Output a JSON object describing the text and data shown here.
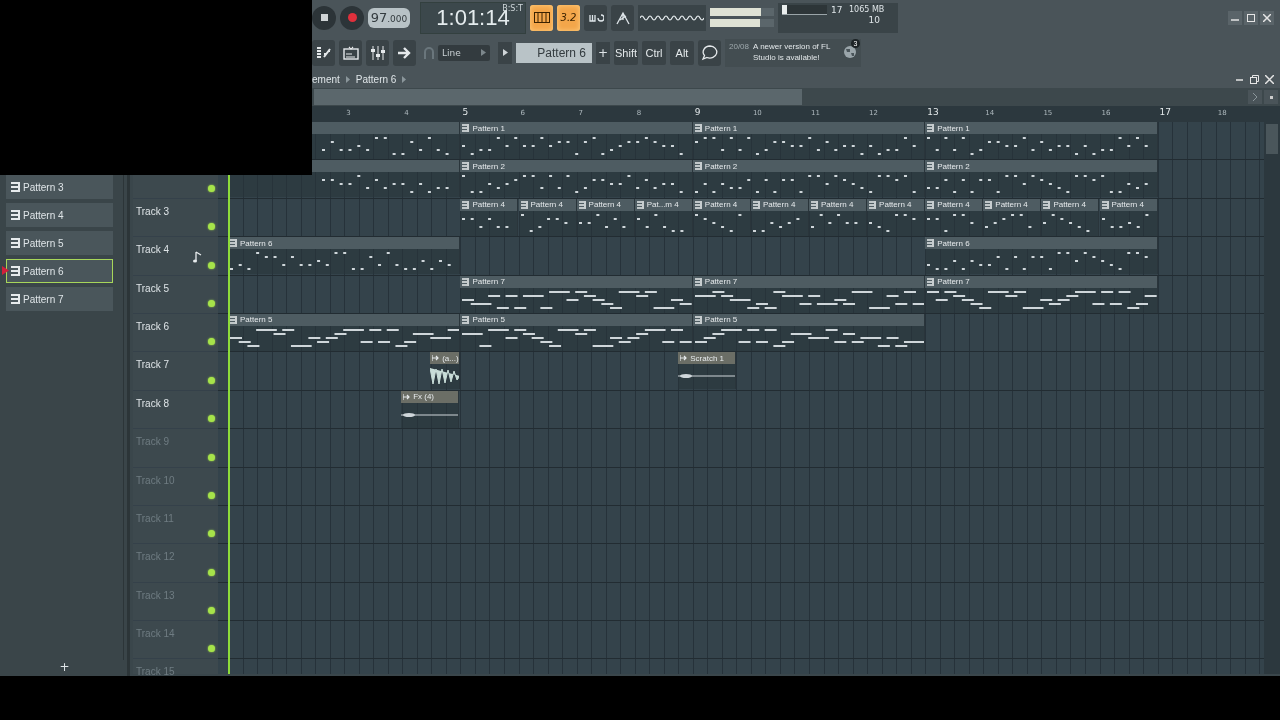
{
  "toolbar": {
    "transport": [
      {
        "kind": "stop"
      },
      {
        "kind": "record"
      }
    ],
    "tempo": {
      "whole": "97",
      "fraction": ".000"
    },
    "song_position": "1:01:14",
    "time_format": "B:S:T",
    "mode_buttons": [
      {
        "kind": "keyboard",
        "on": true
      },
      {
        "kind": "step",
        "label": "3.2",
        "on": true
      },
      {
        "kind": "loop",
        "on": false
      },
      {
        "kind": "metronome",
        "on": false
      }
    ],
    "sliders": [
      {
        "level": 0.8
      },
      {
        "level": 0.78
      }
    ],
    "cpu": {
      "level": 0.1,
      "polyphony": "17",
      "memory": "1065 MB",
      "voices": "10"
    },
    "tools": [
      {
        "kind": "playlist"
      },
      {
        "kind": "channels"
      },
      {
        "kind": "mixer"
      },
      {
        "kind": "arrow"
      }
    ],
    "snap": "Line",
    "pattern": "Pattern 6",
    "pattern_add": "+",
    "modifiers": [
      "Shift",
      "Ctrl",
      "Alt"
    ],
    "hint": {
      "date": "20/08",
      "text": "A newer version of FL Studio is available!",
      "badge": "3"
    }
  },
  "pattern_picker": {
    "items": [
      {
        "label": "Pattern 3",
        "selected": false
      },
      {
        "label": "Pattern 4",
        "selected": false
      },
      {
        "label": "Pattern 5",
        "selected": false
      },
      {
        "label": "Pattern 6",
        "selected": true
      },
      {
        "label": "Pattern 7",
        "selected": false
      }
    ],
    "add": "+"
  },
  "playlist": {
    "breadcrumb": [
      "ement",
      "Pattern 6"
    ],
    "ruler": [
      "3",
      "4",
      "5",
      "6",
      "7",
      "8",
      "9",
      "10",
      "11",
      "12",
      "13",
      "14",
      "15",
      "16",
      "17",
      "18"
    ],
    "tracks": [
      {
        "clips": [
          {
            "kind": "pattern"
          },
          {
            "kind": "pattern",
            "label": "Pattern 1"
          },
          {
            "kind": "pattern",
            "label": "Pattern 1"
          },
          {
            "kind": "pattern",
            "label": "Pattern 1"
          }
        ]
      },
      {
        "enabled": true,
        "clips": [
          {
            "kind": "pattern"
          },
          {
            "kind": "pattern",
            "label": "Pattern 2"
          },
          {
            "kind": "pattern",
            "label": "Pattern 2"
          },
          {
            "kind": "pattern",
            "label": "Pattern 2"
          }
        ]
      },
      {
        "name": "Track 3",
        "empty": false,
        "enabled": true,
        "clips": [
          {
            "kind": "pattern",
            "label": "Pattern 4"
          },
          {
            "kind": "pattern",
            "label": "Pattern 4"
          },
          {
            "kind": "pattern",
            "label": "Pattern 4"
          },
          {
            "kind": "pattern",
            "label": "Pat...m 4"
          },
          {
            "kind": "pattern",
            "label": "Pattern 4"
          },
          {
            "kind": "pattern",
            "label": "Pattern 4"
          },
          {
            "kind": "pattern",
            "label": "Pattern 4"
          },
          {
            "kind": "pattern",
            "label": "Pattern 4"
          },
          {
            "kind": "pattern",
            "label": "Pattern 4"
          },
          {
            "kind": "pattern",
            "label": "Pattern 4"
          },
          {
            "kind": "pattern",
            "label": "Pattern 4"
          },
          {
            "kind": "pattern",
            "label": "Pattern 4"
          }
        ]
      },
      {
        "name": "Track 4",
        "empty": false,
        "enabled": true,
        "current": true,
        "clips": [
          {
            "kind": "pattern",
            "label": "Pattern 6"
          },
          {
            "kind": "pattern",
            "label": "Pattern 6"
          }
        ]
      },
      {
        "name": "Track 5",
        "empty": false,
        "enabled": true,
        "clips": [
          {
            "kind": "pattern",
            "label": "Pattern 7"
          },
          {
            "kind": "pattern",
            "label": "Pattern 7"
          },
          {
            "kind": "pattern",
            "label": "Pattern 7"
          }
        ]
      },
      {
        "name": "Track 6",
        "empty": false,
        "enabled": true,
        "clips": [
          {
            "kind": "pattern",
            "label": "Pattern 5"
          },
          {
            "kind": "pattern",
            "label": "Pattern 5"
          },
          {
            "kind": "pattern",
            "label": "Pattern 5"
          }
        ]
      },
      {
        "name": "Track 7",
        "empty": false,
        "enabled": true,
        "clips": [
          {
            "kind": "audio",
            "label": "(a...)"
          },
          {
            "kind": "audio",
            "label": "Scratch 1"
          }
        ]
      },
      {
        "name": "Track 8",
        "empty": false,
        "enabled": true,
        "clips": [
          {
            "kind": "audio",
            "label": "Fx (4)"
          }
        ]
      },
      {
        "name": "Track 9",
        "empty": true,
        "enabled": true
      },
      {
        "name": "Track 10",
        "empty": true,
        "enabled": true
      },
      {
        "name": "Track 11",
        "empty": true,
        "enabled": true
      },
      {
        "name": "Track 12",
        "empty": true,
        "enabled": true
      },
      {
        "name": "Track 13",
        "empty": true,
        "enabled": true
      },
      {
        "name": "Track 14",
        "empty": true,
        "enabled": true
      },
      {
        "name": "Track 15",
        "empty": true
      }
    ]
  }
}
